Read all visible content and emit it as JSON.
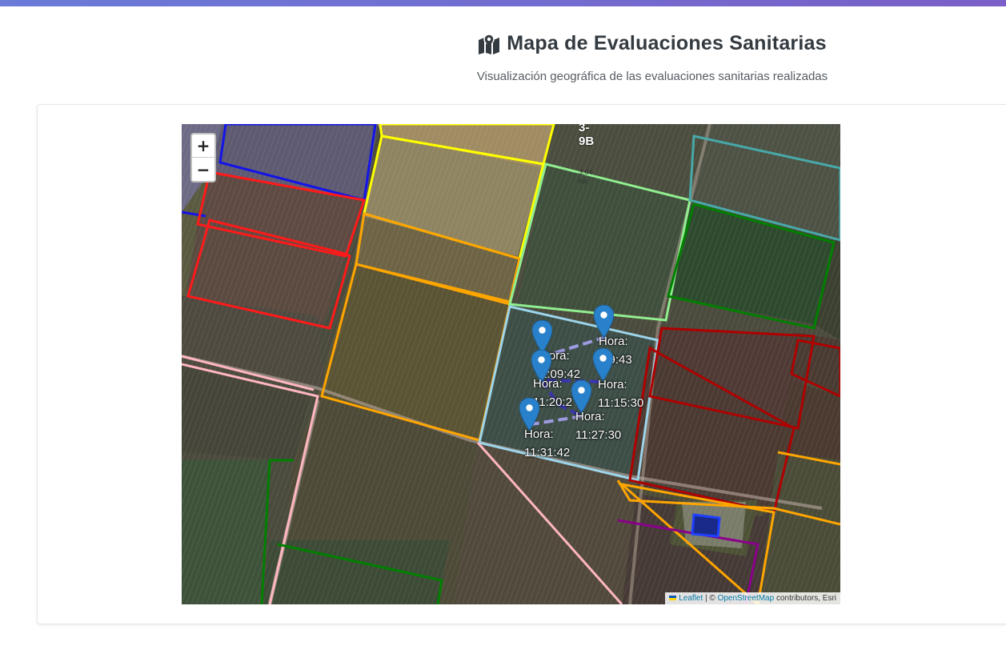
{
  "header": {
    "icon": "map-marked-icon",
    "title": "Mapa de Evaluaciones Sanitarias",
    "subtitle": "Visualización geográfica de las evaluaciones sanitarias realizadas"
  },
  "map": {
    "zoom_in": "+",
    "zoom_out": "−",
    "parcel_label": {
      "name_line1": "3-",
      "name_line2": "9B",
      "area_line1": "3.04",
      "area_line2": "ha"
    },
    "markers": [
      {
        "hora_label": "Hora:",
        "time": "10:59:43",
        "visible_time": ":59:43"
      },
      {
        "hora_label": "Hora:",
        "time": "11:09:42",
        "visible_time": "1:09:42"
      },
      {
        "hora_label": "Hora:",
        "time": "11:15:30",
        "visible_time": "11:15:30"
      },
      {
        "hora_label": "Hora:",
        "time": "11:20:2",
        "visible_time": "11:20:2"
      },
      {
        "hora_label": "Hora:",
        "time": "11:27:30",
        "visible_time": "11:27:30"
      },
      {
        "hora_label": "Hora:",
        "time": "11:31:42",
        "visible_time": "11:31:42"
      }
    ],
    "attribution": {
      "leaflet": "Leaflet",
      "sep": " | © ",
      "osm": "OpenStreetMap",
      "rest": " contributors, Esri"
    },
    "colors": {
      "marker": "#2a81cb",
      "route": "#3a35b0",
      "route_light": "#9d9ae0"
    }
  }
}
